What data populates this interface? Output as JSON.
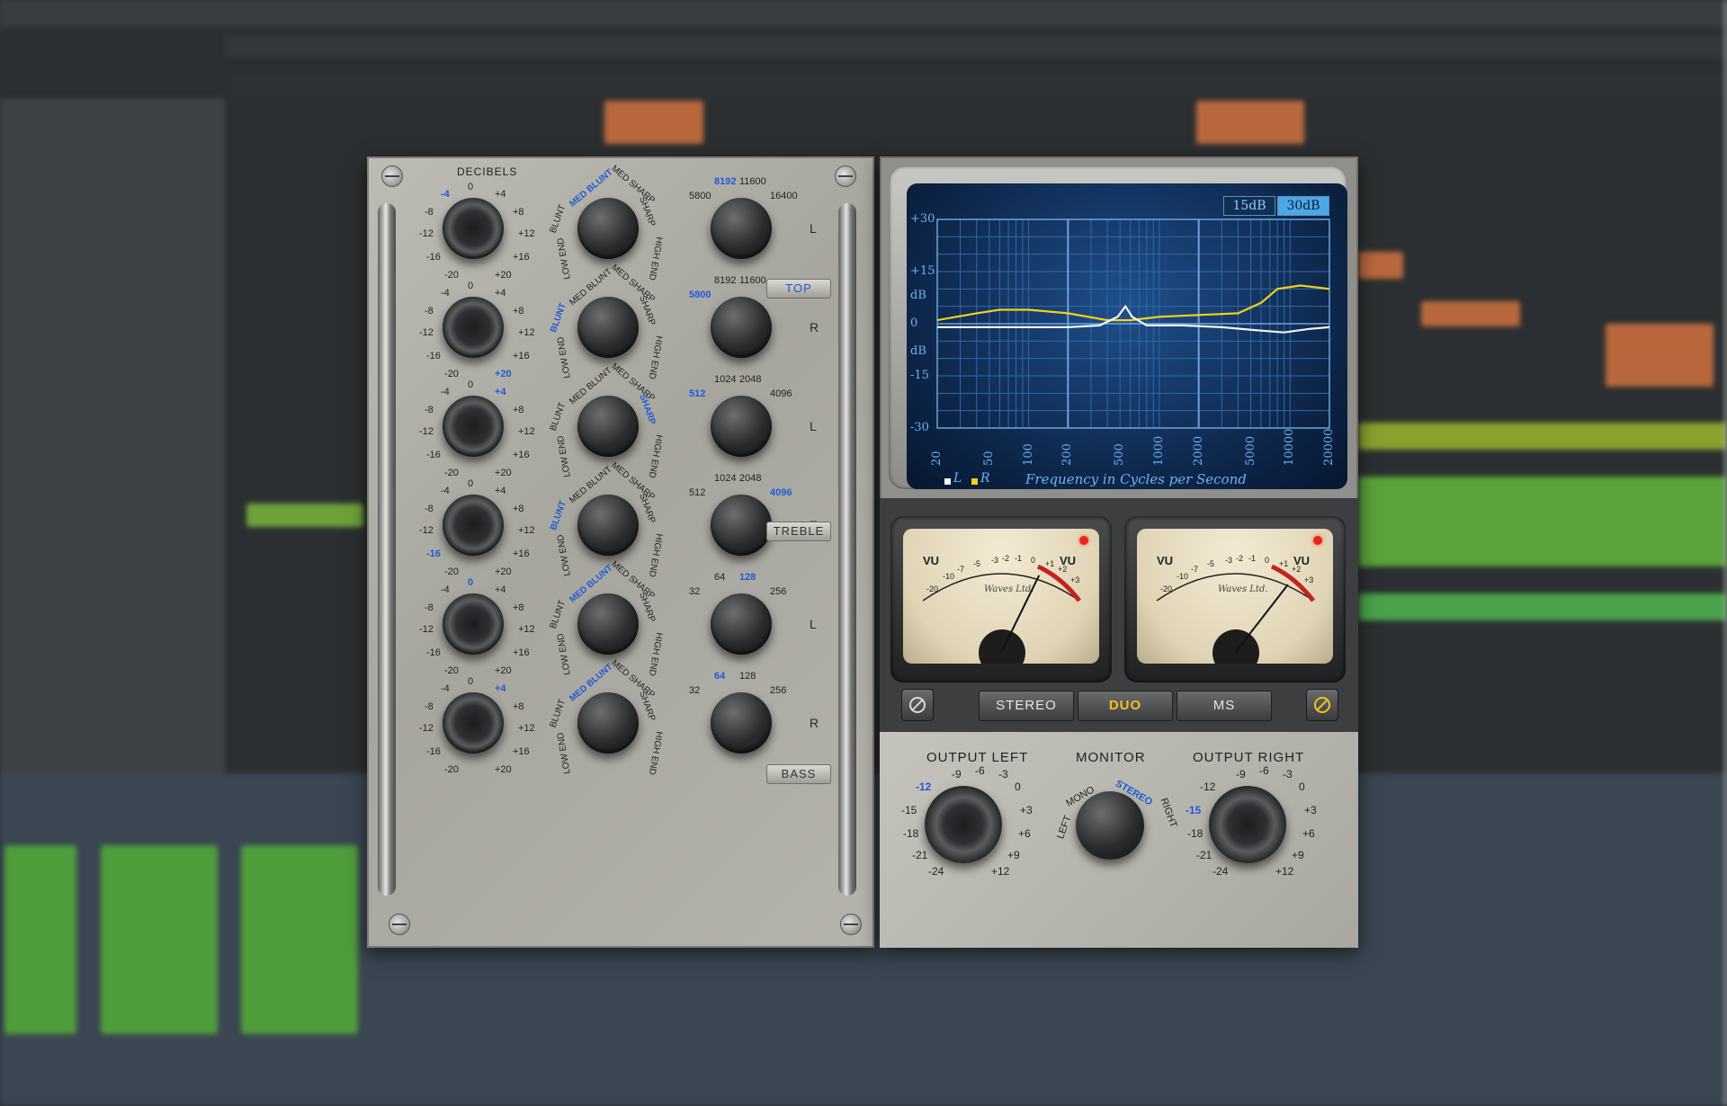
{
  "colors": {
    "selected": "#1e5ad6",
    "gold": "#f2c21c",
    "screen": "#0d2548",
    "left_curve": "#f0d21a",
    "right_curve": "#f4f4f4"
  },
  "eq": {
    "decibels_title": "DECIBELS",
    "section_buttons": {
      "top": "TOP",
      "treble": "TREBLE",
      "bass": "BASS"
    },
    "gain_ticks": [
      "0",
      "+4",
      "+8",
      "+12",
      "+16",
      "+20",
      "-20",
      "-16",
      "-12",
      "-8",
      "-4"
    ],
    "shape_ticks": [
      "BLUNT",
      "MED BLUNT",
      "MED SHARP",
      "SHARP",
      "HIGH END",
      "LOW END"
    ],
    "rows": [
      {
        "channel": "L",
        "gain_sel": "-4",
        "shape_sel": "MED BLUNT",
        "freq_ticks": [
          "5800",
          "8192",
          "11600",
          "16400"
        ],
        "freq_sel": "8192"
      },
      {
        "channel": "R",
        "gain_sel": "+20",
        "shape_sel": "BLUNT",
        "freq_ticks": [
          "5800",
          "8192",
          "11600",
          "16400"
        ],
        "freq_sel": "5800"
      },
      {
        "channel": "L",
        "gain_sel": "+4",
        "shape_sel": "SHARP",
        "freq_ticks": [
          "512",
          "1024",
          "2048",
          "4096"
        ],
        "freq_sel": "512"
      },
      {
        "channel": "R",
        "gain_sel": "-16",
        "shape_sel": "BLUNT",
        "freq_ticks": [
          "512",
          "1024",
          "2048",
          "4096"
        ],
        "freq_sel": "4096"
      },
      {
        "channel": "L",
        "gain_sel": "0",
        "shape_sel": "MED BLUNT",
        "freq_ticks": [
          "32",
          "64",
          "128",
          "256"
        ],
        "freq_sel": "128"
      },
      {
        "channel": "R",
        "gain_sel": "+4",
        "shape_sel": "MED BLUNT",
        "freq_ticks": [
          "32",
          "64",
          "128",
          "256"
        ],
        "freq_sel": "64"
      }
    ]
  },
  "graph": {
    "scale_buttons": [
      "15dB",
      "30dB"
    ],
    "active_scale": "30dB",
    "y_labels": [
      "+30",
      "+15",
      "dB",
      "0",
      "dB",
      "-15",
      "-30"
    ],
    "x_labels": [
      "20",
      "50",
      "100",
      "200",
      "500",
      "1000",
      "2000",
      "5000",
      "10000",
      "20000"
    ],
    "caption": "Frequency in Cycles per Second",
    "legend": [
      {
        "name": "L"
      },
      {
        "name": "R"
      }
    ]
  },
  "meters": {
    "scale": [
      "-20",
      "-10",
      "-7",
      "-5",
      "-3",
      "-2",
      "-1",
      "0",
      "+1",
      "+2",
      "+3"
    ],
    "label": "VU",
    "brand": "Waves Ltd.",
    "left_level_db": -2.5,
    "right_level_db": 0.2
  },
  "modes": {
    "stereo": "STEREO",
    "duo": "DUO",
    "ms": "MS",
    "active": "DUO"
  },
  "output": {
    "left_title": "OUTPUT LEFT",
    "monitor_title": "MONITOR",
    "right_title": "OUTPUT RIGHT",
    "out_ticks": [
      "-9",
      "-6",
      "-3",
      "0",
      "+3",
      "+6",
      "+9",
      "+12",
      "-24",
      "-21",
      "-18",
      "-15",
      "-12"
    ],
    "left_sel": "-12",
    "right_sel": "-15",
    "monitor_options": [
      "LEFT",
      "MONO",
      "STEREO",
      "RIGHT"
    ],
    "monitor_sel": "STEREO"
  }
}
